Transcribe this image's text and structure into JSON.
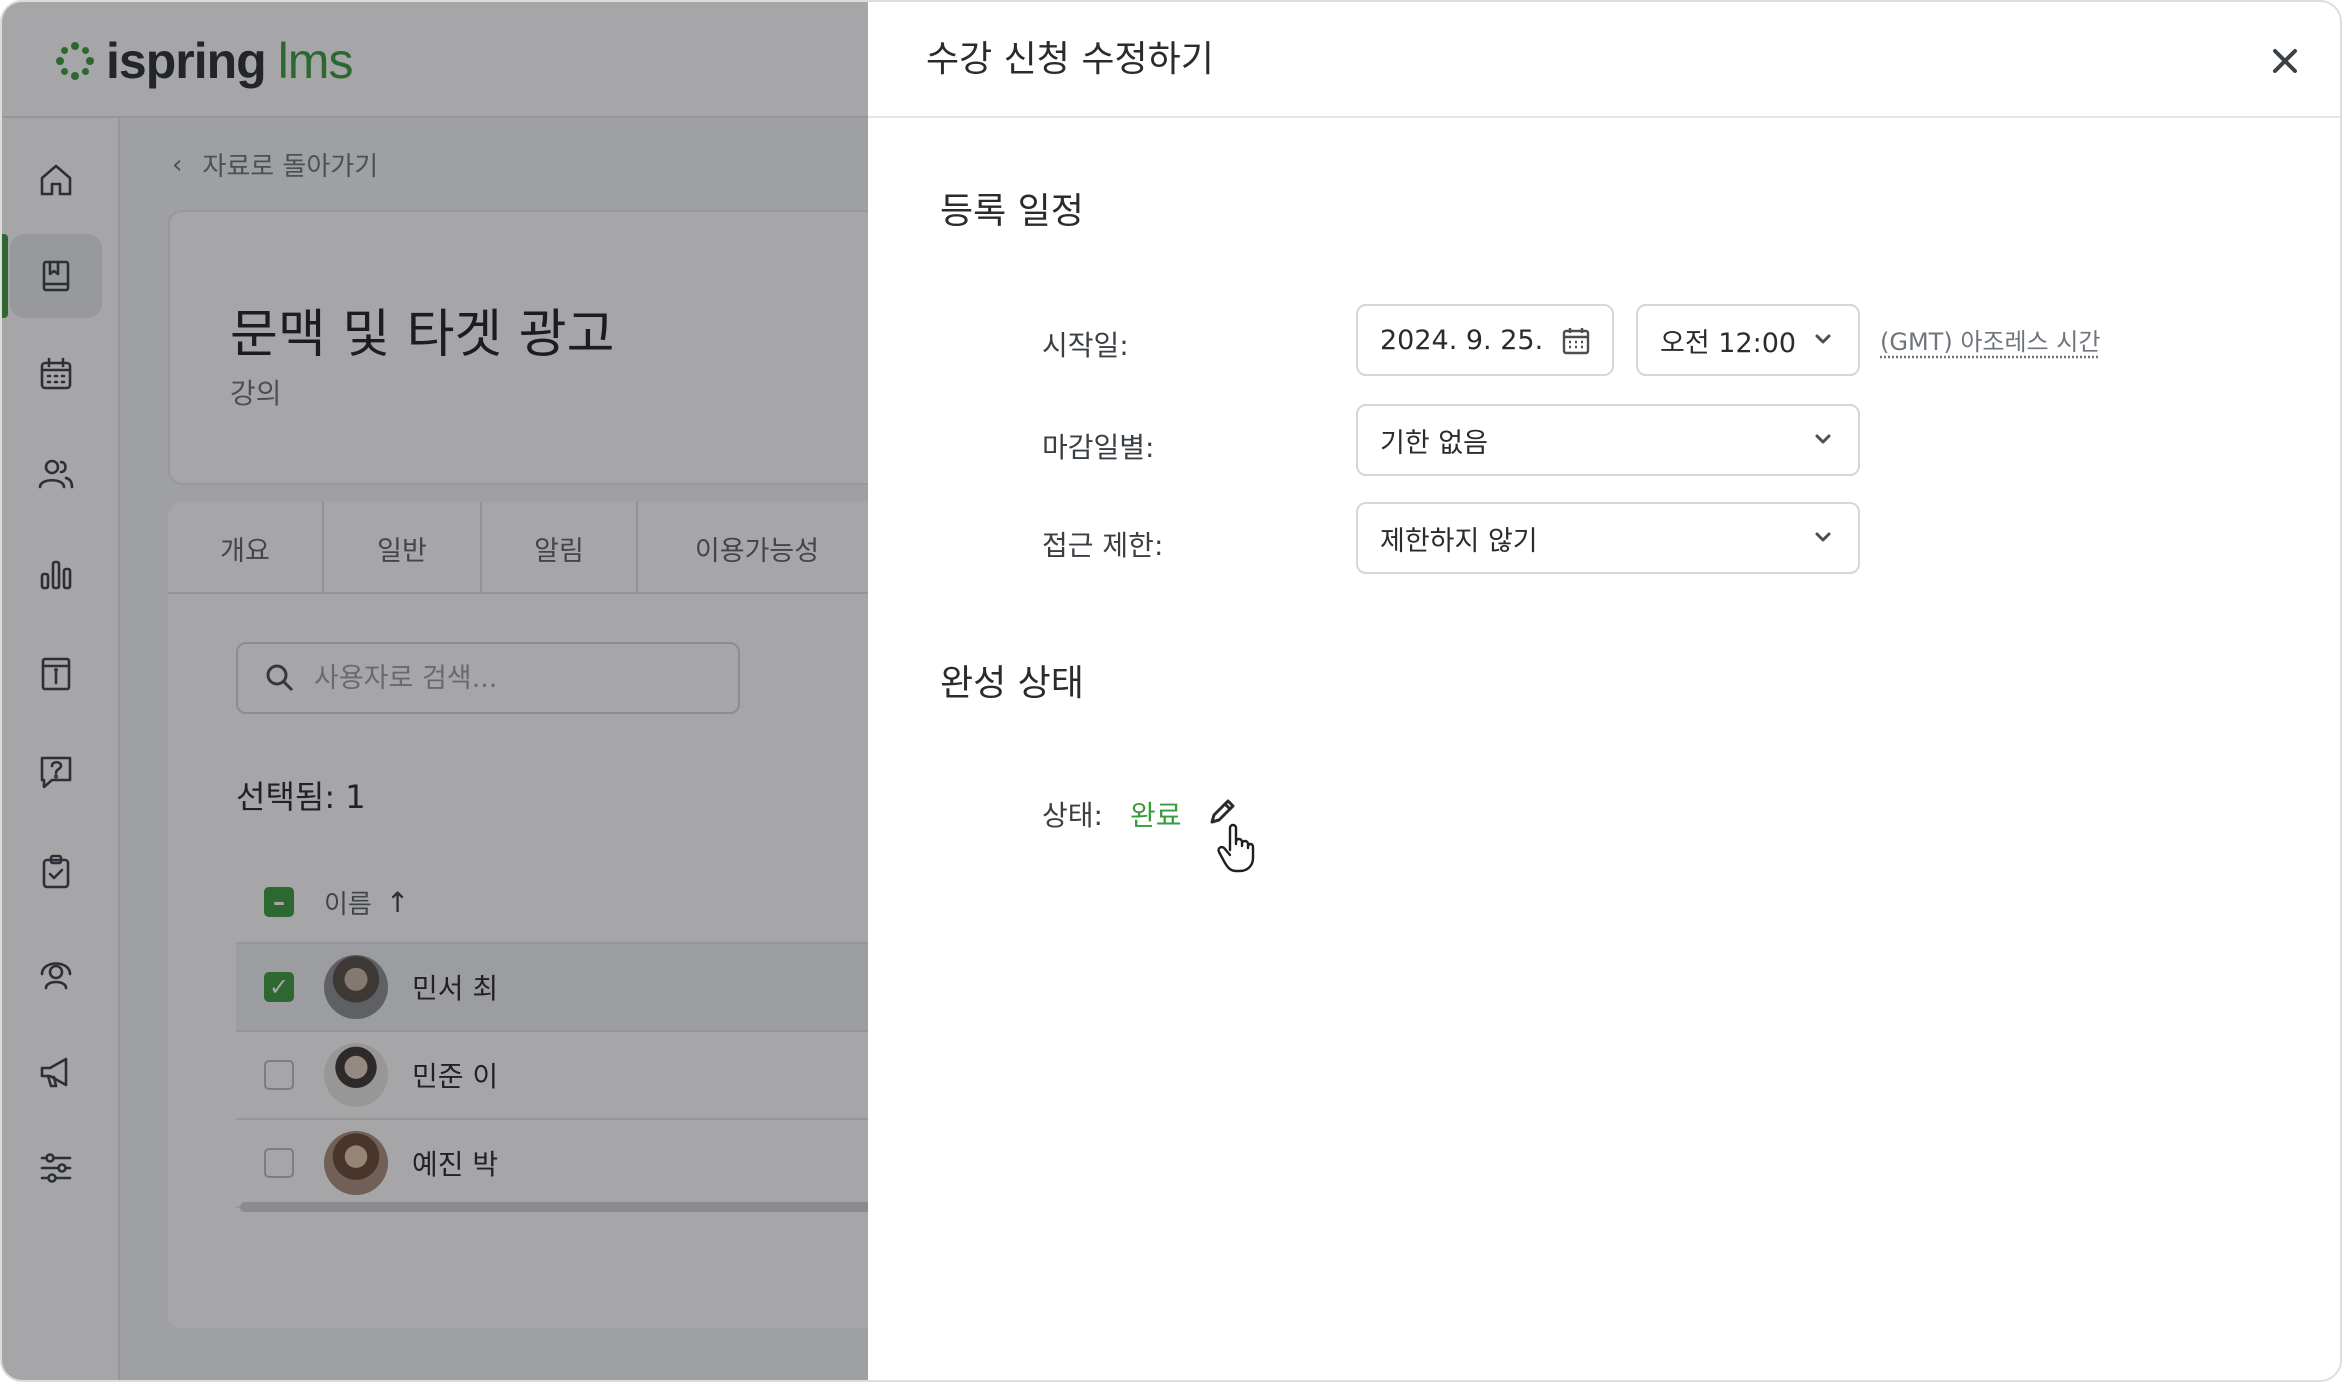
{
  "app": {
    "logo_word1": "ispring",
    "logo_word2": "lms",
    "brand_color": "#3a9b3c"
  },
  "sidebar": {
    "icons": [
      "home-icon",
      "courses-icon",
      "calendar-icon",
      "users-icon",
      "reports-icon",
      "info-icon",
      "help-icon",
      "assignments-icon",
      "support-icon",
      "announcements-icon",
      "settings-icon"
    ],
    "active": "courses-icon"
  },
  "background": {
    "back_link": "자료로 돌아가기",
    "course_title": "문맥 및 타겟 광고",
    "course_type": "강의",
    "tabs": [
      "개요",
      "일반",
      "알림",
      "이용가능성"
    ],
    "search_placeholder": "사용자로 검색...",
    "selected_text": "선택됨: 1",
    "column_name": "이름",
    "sort_icon": "arrow-up-icon",
    "users": [
      {
        "name": "민서 최",
        "checked": true
      },
      {
        "name": "민준 이",
        "checked": false
      },
      {
        "name": "예진 박",
        "checked": false
      }
    ]
  },
  "drawer": {
    "title": "수강 신청 수정하기",
    "schedule": {
      "section_title": "등록 일정",
      "start_label": "시작일:",
      "start_date": "2024. 9. 25.",
      "start_time": "오전 12:00",
      "timezone": "(GMT) 아조레스 시간",
      "due_label": "마감일별:",
      "due_value": "기한 없음",
      "access_label": "접근 제한:",
      "access_value": "제한하지 않기"
    },
    "completion": {
      "section_title": "완성 상태",
      "status_label": "상태:",
      "status_value": "완료",
      "status_color": "#3a9b3c"
    }
  }
}
